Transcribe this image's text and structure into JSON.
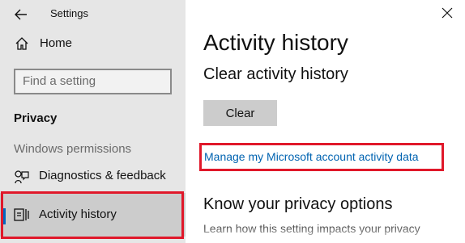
{
  "window": {
    "title": "Settings"
  },
  "sidebar": {
    "home_label": "Home",
    "search_placeholder": "Find a setting",
    "section_title": "Privacy",
    "subsection_title": "Windows permissions",
    "items": [
      {
        "label": "Diagnostics & feedback",
        "icon": "diagnostics-icon",
        "selected": false
      },
      {
        "label": "Activity history",
        "icon": "activity-history-icon",
        "selected": true
      }
    ]
  },
  "main": {
    "title": "Activity history",
    "clear_heading": "Clear activity history",
    "clear_button": "Clear",
    "manage_link": "Manage my Microsoft account activity data",
    "privacy_heading": "Know your privacy options",
    "learn_text": "Learn how this setting impacts your privacy"
  },
  "colors": {
    "sidebar_bg": "#e6e6e6",
    "selected_bg": "#cccccc",
    "accent": "#0067c0",
    "link": "#0063b1",
    "highlight_box": "#e0182a"
  }
}
